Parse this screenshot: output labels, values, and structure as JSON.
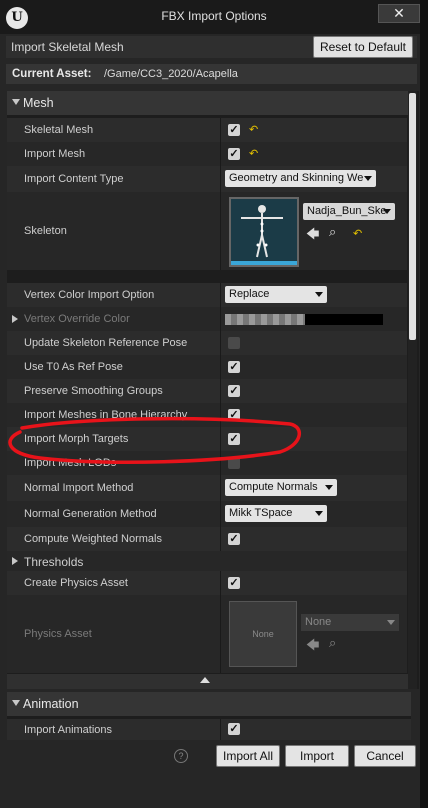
{
  "window": {
    "title": "FBX Import Options",
    "close_glyph": "✕"
  },
  "header": {
    "mode_title": "Import Skeletal Mesh",
    "reset_label": "Reset to Default"
  },
  "asset": {
    "label": "Current Asset:",
    "path": "/Game/CC3_2020/Acapella"
  },
  "mesh_section": {
    "title": "Mesh",
    "rows": {
      "skeletal_mesh": "Skeletal Mesh",
      "import_mesh": "Import Mesh",
      "import_content_type": "Import Content Type",
      "skeleton": "Skeleton",
      "vertex_color_import_option": "Vertex Color Import Option",
      "vertex_override_color": "Vertex Override Color",
      "update_skeleton_reference_pose": "Update Skeleton Reference Pose",
      "use_t0_as_ref_pose": "Use T0 As Ref Pose",
      "preserve_smoothing_groups": "Preserve Smoothing Groups",
      "import_meshes_in_bone_hierarchy": "Import Meshes in Bone Hierarchy",
      "import_morph_targets": "Import Morph Targets",
      "import_mesh_lods": "Import Mesh LODs",
      "normal_import_method": "Normal Import Method",
      "normal_generation_method": "Normal Generation Method",
      "compute_weighted_normals": "Compute Weighted Normals",
      "thresholds": "Thresholds",
      "create_physics_asset": "Create Physics Asset",
      "physics_asset": "Physics Asset"
    },
    "values": {
      "import_content_type": "Geometry and Skinning We",
      "skeleton": "Nadja_Bun_Ske",
      "vertex_color_import_option": "Replace",
      "normal_import_method": "Compute Normals",
      "normal_generation_method": "Mikk TSpace",
      "physics_asset": "None",
      "physics_thumb": "None"
    },
    "checkboxes": {
      "skeletal_mesh": true,
      "import_mesh": true,
      "update_skeleton_reference_pose": false,
      "use_t0_as_ref_pose": true,
      "preserve_smoothing_groups": true,
      "import_meshes_in_bone_hierarchy": true,
      "import_morph_targets": true,
      "import_mesh_lods": false,
      "compute_weighted_normals": true,
      "create_physics_asset": true
    }
  },
  "animation_section": {
    "title": "Animation",
    "rows": {
      "import_animations": "Import Animations"
    },
    "checkboxes": {
      "import_animations": true
    }
  },
  "footer": {
    "help_glyph": "?",
    "import_all": "Import All",
    "import": "Import",
    "cancel": "Cancel"
  },
  "glyphs": {
    "check": "✓",
    "revert": "↶",
    "back_arrow": "🡄",
    "search": "⌕"
  },
  "colors": {
    "accent_annotation": "#e8131a",
    "revert_icon": "#e6c300",
    "thumbnail_bar": "#3aa6d8"
  }
}
